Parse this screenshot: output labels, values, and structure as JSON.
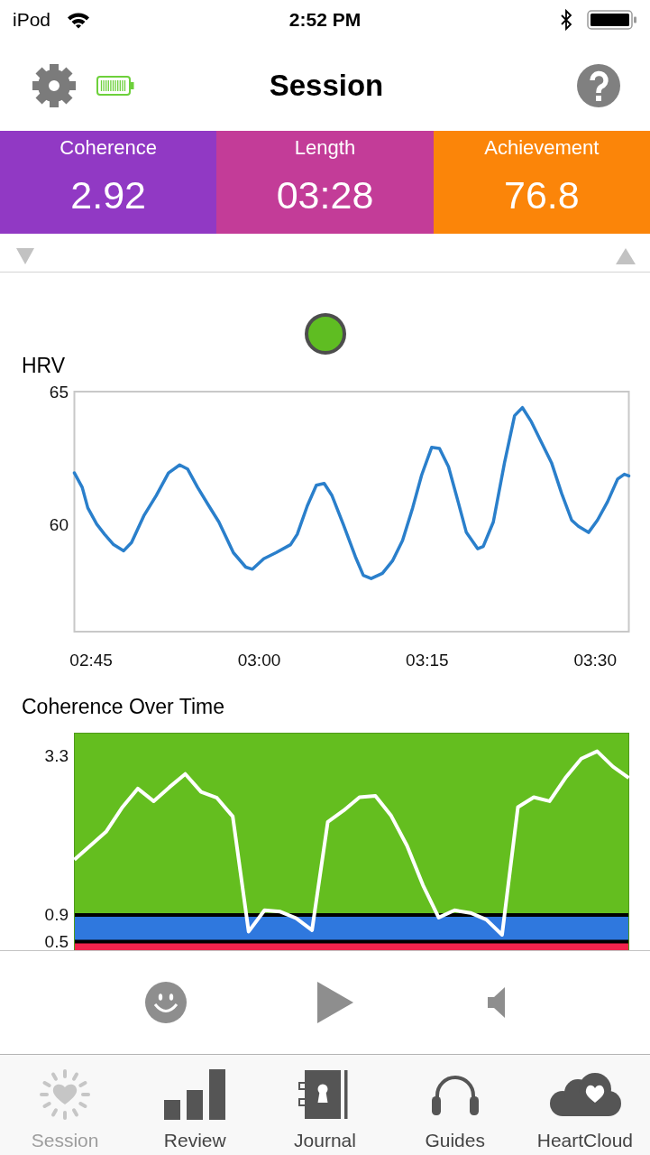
{
  "status_bar": {
    "carrier": "iPod",
    "time": "2:52 PM"
  },
  "nav_bar": {
    "title": "Session"
  },
  "stats": [
    {
      "label": "Coherence",
      "value": "2.92",
      "color": "#9139c4"
    },
    {
      "label": "Length",
      "value": "03:28",
      "color": "#c33c98"
    },
    {
      "label": "Achievement",
      "value": "76.8",
      "color": "#fb8509"
    }
  ],
  "indicator": {
    "color": "#5fbd22"
  },
  "hrv_chart": {
    "chart_data": {
      "type": "line",
      "title": "HRV",
      "x": [
        163.5,
        164.2,
        164.7,
        165.5,
        166.2,
        167.0,
        167.9,
        168.6,
        169.7,
        170.8,
        171.9,
        172.9,
        173.6,
        174.5,
        175.5,
        176.4,
        177.7,
        178.8,
        179.4,
        180.4,
        181.5,
        182.8,
        183.4,
        184.3,
        185.1,
        185.8,
        186.5,
        187.5,
        188.6,
        189.3,
        190.0,
        191.0,
        191.9,
        192.8,
        193.7,
        194.5,
        195.4,
        196.1,
        196.9,
        197.8,
        198.5,
        199.5,
        200.0,
        200.9,
        201.9,
        202.8,
        203.5,
        204.3,
        205.2,
        206.1,
        207.0,
        207.9,
        208.5,
        209.4,
        210.2,
        211.1,
        212.0,
        212.6,
        213.0
      ],
      "series": [
        {
          "color": "#2a7fcb",
          "values": [
            61.95,
            61.41,
            60.64,
            60.03,
            59.65,
            59.26,
            59.03,
            59.34,
            60.34,
            61.1,
            61.95,
            62.25,
            62.1,
            61.41,
            60.72,
            60.11,
            58.96,
            58.42,
            58.34,
            58.73,
            58.96,
            59.26,
            59.65,
            60.72,
            61.49,
            61.56,
            61.1,
            60.03,
            58.8,
            58.11,
            57.99,
            58.19,
            58.65,
            59.42,
            60.64,
            61.87,
            62.91,
            62.87,
            62.18,
            60.8,
            59.72,
            59.11,
            59.19,
            60.11,
            62.33,
            64.1,
            64.4,
            63.87,
            63.1,
            62.33,
            61.18,
            60.18,
            59.95,
            59.72,
            60.18,
            60.87,
            61.72,
            61.9,
            61.84
          ]
        }
      ],
      "xlim": [
        163.5,
        213
      ],
      "ylim": [
        56,
        65
      ],
      "xticks": [
        {
          "value": 165,
          "label": "02:45"
        },
        {
          "value": 180,
          "label": "03:00"
        },
        {
          "value": 195,
          "label": "03:15"
        },
        {
          "value": 210,
          "label": "03:30"
        }
      ],
      "yticks": [
        60,
        65
      ]
    }
  },
  "coherence_chart": {
    "chart_data": {
      "type": "line",
      "title": "Coherence Over Time",
      "series": [
        {
          "color": "#ffffff",
          "values": [
            1.73,
            1.94,
            2.15,
            2.51,
            2.8,
            2.61,
            2.82,
            3.02,
            2.75,
            2.66,
            2.38,
            0.65,
            0.97,
            0.95,
            0.85,
            0.67,
            2.3,
            2.47,
            2.67,
            2.69,
            2.39,
            1.94,
            1.35,
            0.86,
            0.97,
            0.93,
            0.83,
            0.6,
            2.52,
            2.67,
            2.61,
            2.96,
            3.25,
            3.36,
            3.13,
            2.96
          ]
        }
      ],
      "ylim": [
        0.37,
        3.64
      ],
      "yticks": [
        0.5,
        0.9,
        3.3
      ],
      "bands": [
        {
          "axis": "y",
          "from": 0.9,
          "to": 3.64,
          "color": "#64be1f"
        },
        {
          "axis": "y",
          "from": 0.5,
          "to": 0.9,
          "color": "#2f78de"
        },
        {
          "axis": "y",
          "from": 0.37,
          "to": 0.5,
          "color": "#f2234c"
        }
      ],
      "ref_lines": [
        {
          "axis": "y",
          "value": 0.9,
          "color": "#000000"
        },
        {
          "axis": "y",
          "value": 0.5,
          "color": "#000000"
        }
      ]
    }
  },
  "tab_bar": [
    {
      "label": "Session",
      "selected": true
    },
    {
      "label": "Review",
      "selected": false
    },
    {
      "label": "Journal",
      "selected": false
    },
    {
      "label": "Guides",
      "selected": false
    },
    {
      "label": "HeartCloud",
      "selected": false
    }
  ]
}
